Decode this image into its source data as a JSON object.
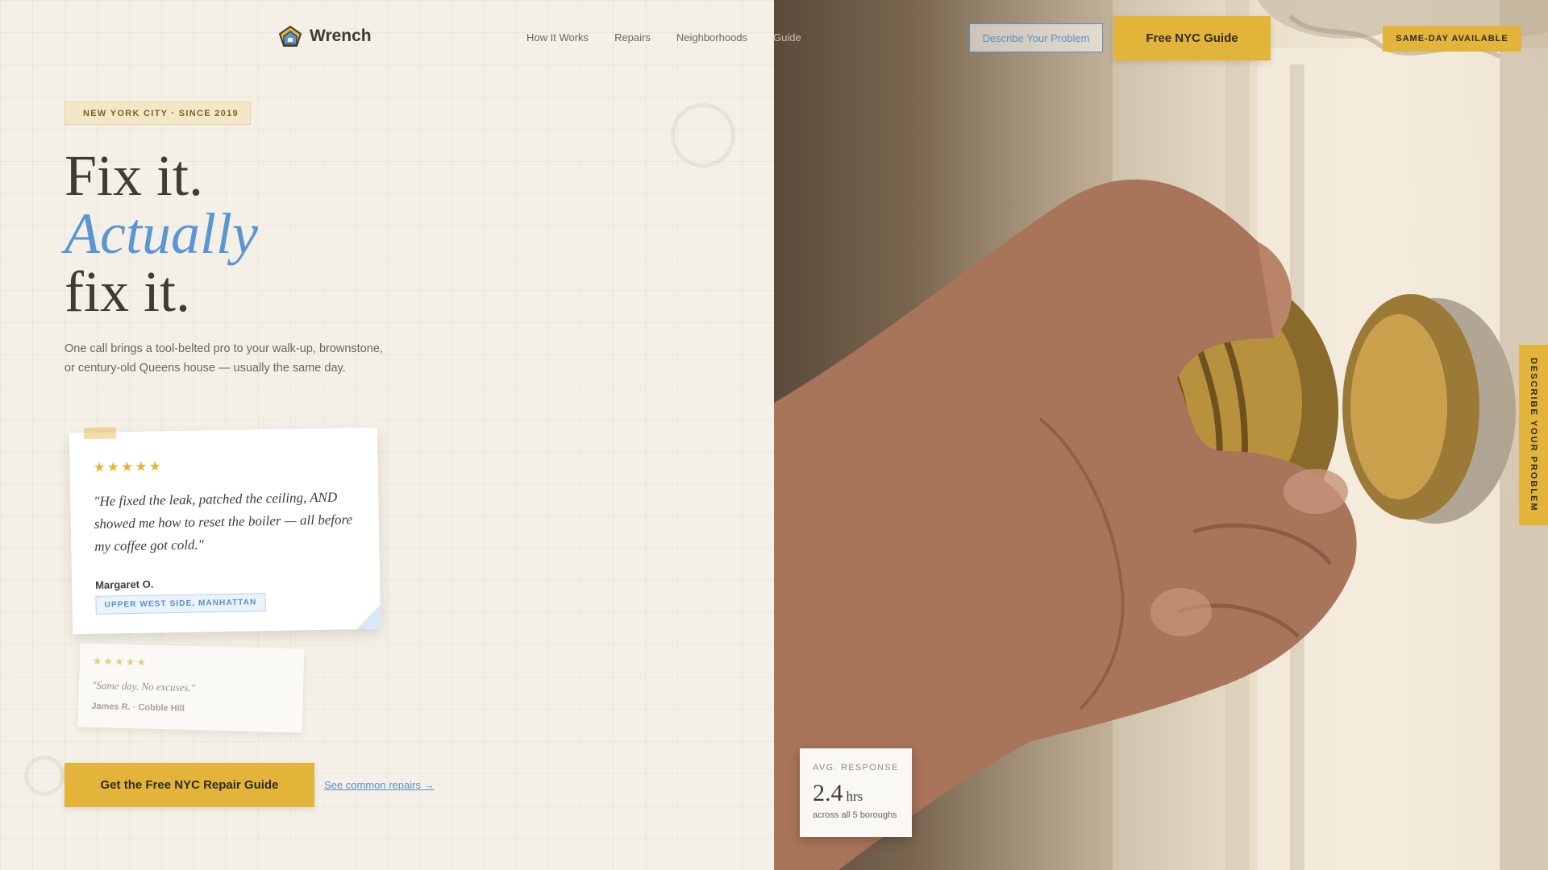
{
  "brand": {
    "name": "Wrench",
    "logo_icon": "wrench-house-logo-icon"
  },
  "nav": {
    "items": [
      "How It Works",
      "Repairs",
      "Neighborhoods",
      "Guide"
    ]
  },
  "header": {
    "describe_button": "Describe Your Problem",
    "guide_button": "Free NYC Guide",
    "same_day_badge": "SAME-DAY AVAILABLE"
  },
  "hero": {
    "tag_icon": "",
    "tag_text": "NEW YORK CITY · SINCE 2019",
    "headline": [
      "Fix it.",
      "Actually",
      "fix it."
    ],
    "subtext": "One call brings a tool-belted pro to your walk-up, brownstone, or century-old Queens house — usually the same day."
  },
  "testimonials": [
    {
      "stars": "★★★★★",
      "quote": "\"He fixed the leak, patched the ceiling, AND showed me how to reset the boiler — all before my coffee got cold.\"",
      "author": "Margaret O.",
      "location": "UPPER WEST SIDE, MANHATTAN"
    },
    {
      "stars": "★★★★★",
      "quote": "\"Same day. No excuses.\"",
      "author": "James R. · Cobble Hill"
    }
  ],
  "cta": {
    "primary": "Get the Free NYC Repair Guide",
    "secondary": "See common repairs →"
  },
  "stat": {
    "label": "AVG. RESPONSE",
    "value": "2.4",
    "unit": "hrs",
    "note": "across all 5 boroughs"
  },
  "side_tab": "DESCRIBE YOUR PROBLEM",
  "colors": {
    "accent_yellow": "#e2b53a",
    "accent_blue": "#5b96d2",
    "background": "#f4f0e8"
  }
}
